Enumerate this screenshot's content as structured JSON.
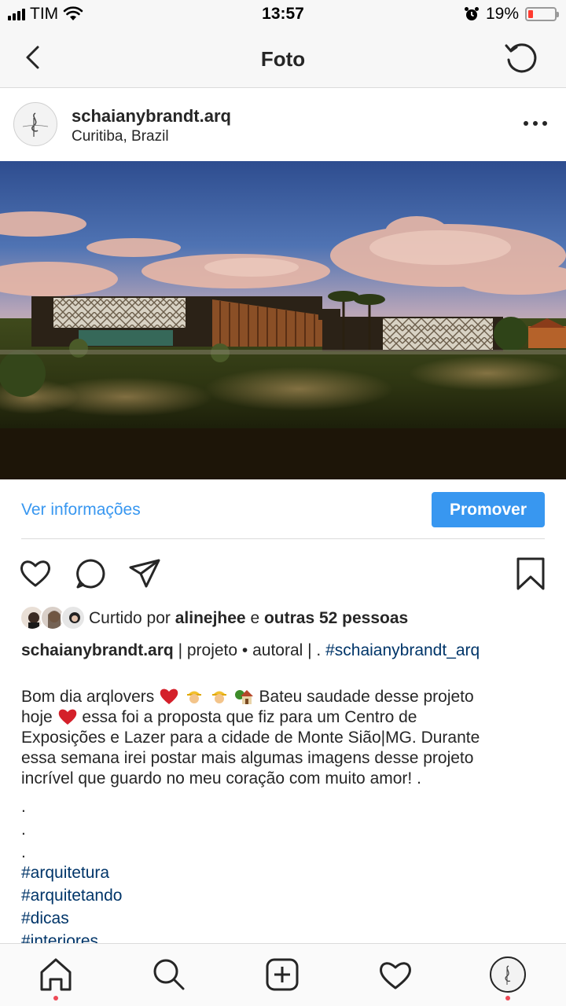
{
  "status_bar": {
    "carrier": "TIM",
    "time": "13:57",
    "battery": "19%",
    "battery_level": 0.19,
    "icons": [
      "signal-icon",
      "wifi-icon",
      "alarm-icon",
      "battery-icon"
    ]
  },
  "nav": {
    "title": "Foto",
    "back_icon": "chevron-left-icon",
    "refresh_icon": "refresh-icon"
  },
  "post": {
    "username": "schaianybrandt.arq",
    "location": "Curitiba, Brazil",
    "more_icon": "more-icon"
  },
  "info_row": {
    "ver_info": "Ver informações",
    "promote": "Promover"
  },
  "actions": {
    "icons": [
      "heart-icon",
      "comment-icon",
      "share-icon",
      "bookmark-icon"
    ]
  },
  "likes": {
    "prefix": "Curtido por ",
    "user": "alinejhee",
    "connector": " e ",
    "others": "outras 52 pessoas"
  },
  "caption": {
    "username": "schaianybrandt.arq",
    "text": " | projeto • autoral | . ",
    "hashtag": "#schaianybrandt_arq",
    "body_1": "Bom dia arqlovers",
    "body_2": "Bateu saudade desse projeto",
    "body_3": "hoje",
    "body_4": "essa foi a proposta que fiz para um Centro de",
    "body_5": "Exposições e Lazer para a cidade de Monte Sião|MG. Durante",
    "body_6": "essa semana irei postar mais algumas imagens desse projeto",
    "body_7": "incrível que guardo no meu coração com muito amor! .",
    "dots": [
      ".",
      ".",
      "."
    ],
    "hashtags": [
      "#arquitetura",
      "#arquitetando",
      "#dicas",
      "#interiores"
    ]
  },
  "tab_bar": {
    "icons": [
      "home-icon",
      "search-icon",
      "add-post-icon",
      "activity-icon",
      "profile-icon"
    ]
  },
  "colors": {
    "link_blue": "#3897f0",
    "hashtag_blue": "#003569",
    "notification_red": "#ed4956"
  }
}
